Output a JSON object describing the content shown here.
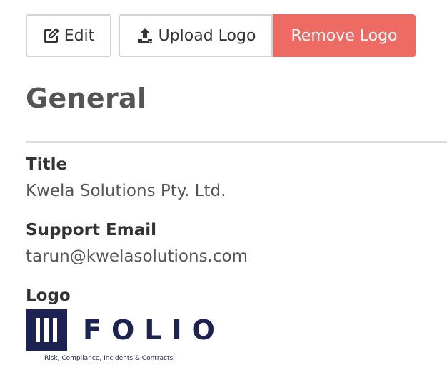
{
  "toolbar": {
    "edit_label": "Edit",
    "upload_label": "Upload Logo",
    "remove_label": "Remove Logo",
    "remove_color": "#ee6b64",
    "edit_icon": "edit-icon",
    "upload_icon": "upload-icon"
  },
  "section": {
    "title": "General"
  },
  "fields": {
    "title_label": "Title",
    "title_value": "Kwela Solutions Pty. Ltd.",
    "email_label": "Support Email",
    "email_value": "tarun@kwelasolutions.com",
    "logo_label": "Logo"
  },
  "logo": {
    "wordmark": "FOLIO",
    "tagline": "Risk, Compliance, Incidents & Contracts",
    "brand_color": "#1d2351"
  }
}
